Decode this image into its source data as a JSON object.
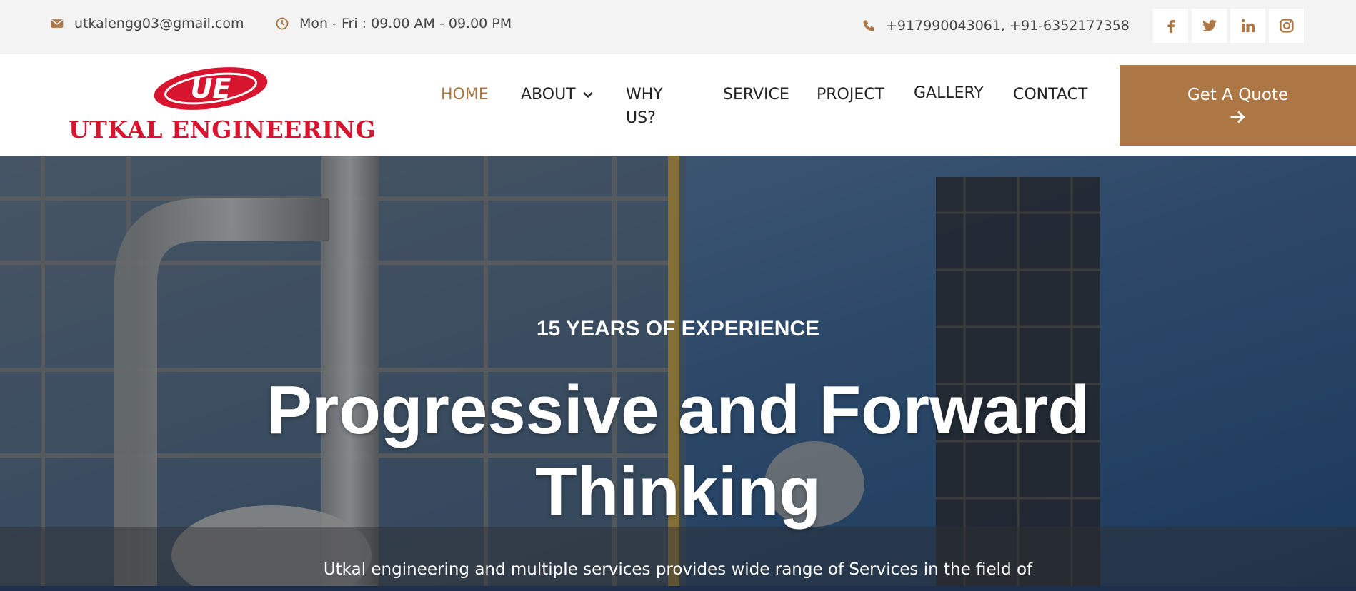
{
  "topbar": {
    "email": "utkalengg03@gmail.com",
    "hours": "Mon - Fri : 09.00 AM - 09.00 PM",
    "phone": "+917990043061, +91-6352177358",
    "social": [
      "facebook-icon",
      "twitter-icon",
      "linkedin-icon",
      "instagram-icon"
    ]
  },
  "logo": {
    "mark": "UE",
    "name": "UTKAL ENGINEERING"
  },
  "nav": {
    "items": [
      {
        "label": "HOME",
        "active": true
      },
      {
        "label": "ABOUT",
        "has_dropdown": true
      },
      {
        "label": "WHY US?"
      },
      {
        "label": "SERVICE"
      },
      {
        "label": "PROJECT"
      },
      {
        "label": "GALLERY"
      },
      {
        "label": "CONTACT"
      }
    ],
    "cta": "Get A Quote"
  },
  "hero": {
    "kicker": "15 YEARS OF EXPERIENCE",
    "headline": "Progressive and Forward Thinking",
    "description": "Utkal engineering and multiple services provides wide range of Services in the field of"
  },
  "colors": {
    "accent": "#ad7745",
    "brand_red": "#d8152f",
    "topbar_bg": "#f3f3f3"
  }
}
